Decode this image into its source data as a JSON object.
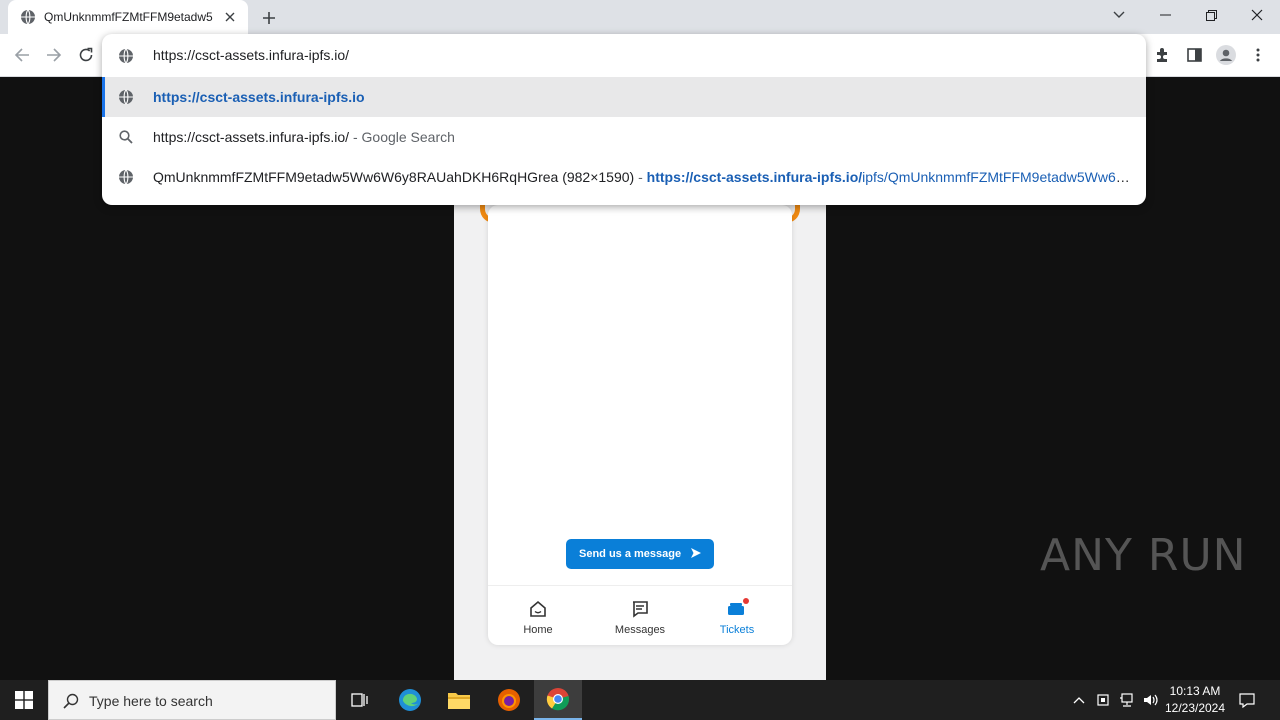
{
  "browser": {
    "tab": {
      "title": "QmUnknmmfFZMtFFM9etadw5",
      "icon": "globe-icon"
    },
    "omnibox": {
      "input_text": "https://csct-assets.infura-ipfs.io/",
      "suggestions": [
        {
          "icon": "globe-icon",
          "url_bold": "https://csct-assets.infura-ipfs.io"
        },
        {
          "icon": "search-icon",
          "query": "https://csct-assets.infura-ipfs.io/",
          "suffix": " - Google Search"
        },
        {
          "icon": "globe-icon",
          "title": "QmUnknmmfFZMtFFM9etadw5Ww6W6y8RAUahDKH6RqHGrea (982×1590)",
          "separator": " - ",
          "url_bold": "https://csct-assets.infura-ipfs.io/",
          "url_rest": "ipfs/QmUnknmmfFZMtFFM9etadw5Ww6W..."
        }
      ]
    }
  },
  "page": {
    "send_button_label": "Send us a message",
    "nav": [
      {
        "label": "Home",
        "icon": "home-icon",
        "active": false
      },
      {
        "label": "Messages",
        "icon": "message-icon",
        "active": false
      },
      {
        "label": "Tickets",
        "icon": "ticket-icon",
        "active": true
      }
    ],
    "accent_color": "#0a7fd8",
    "frame_color": "#f08a12"
  },
  "watermark": {
    "text": "ANY RUN"
  },
  "taskbar": {
    "search_placeholder": "Type here to search",
    "time": "10:13 AM",
    "date": "12/23/2024"
  }
}
